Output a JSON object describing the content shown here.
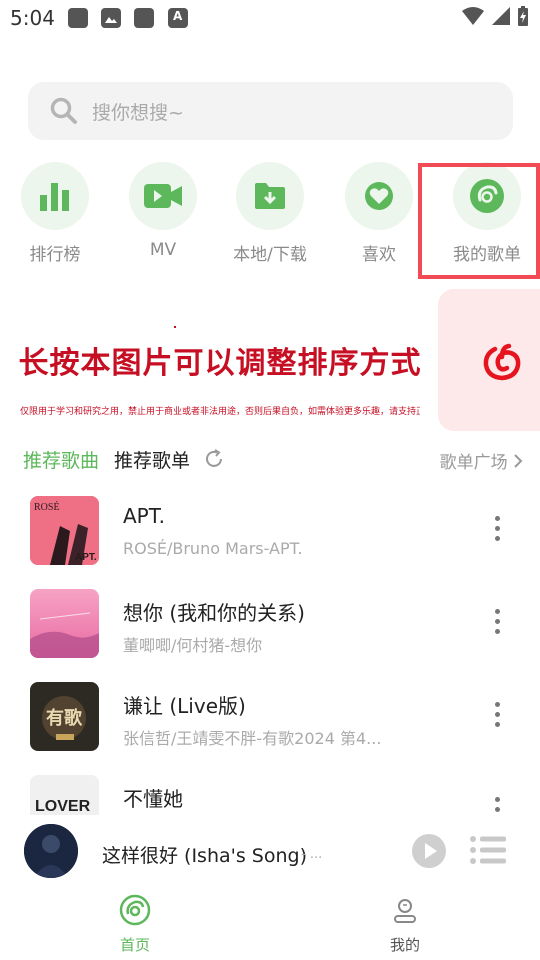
{
  "status_bar": {
    "time": "5:04"
  },
  "search": {
    "placeholder": "搜你想搜~"
  },
  "quick_menu": [
    {
      "label": "排行榜",
      "icon": "bar-chart-icon"
    },
    {
      "label": "MV",
      "icon": "video-camera-icon"
    },
    {
      "label": "本地/下载",
      "icon": "download-folder-icon"
    },
    {
      "label": "喜欢",
      "icon": "heart-icon"
    },
    {
      "label": "我的歌单",
      "icon": "disc-icon"
    }
  ],
  "banner": {
    "title": "长按本图片可以调整排序方式",
    "subtitle": "仅限用于学习和研究之用，禁止用于商业或者非法用途，否则后果自负，如需体验更多乐趣，请支持正版音乐！"
  },
  "tabs": {
    "recommend_songs": "推荐歌曲",
    "recommend_playlists": "推荐歌单",
    "plaza": "歌单广场"
  },
  "songs": [
    {
      "title": "APT.",
      "subtitle": "ROSÉ/Bruno Mars-APT."
    },
    {
      "title": "想你 (我和你的关系)",
      "subtitle": "董唧唧/何村猪-想你"
    },
    {
      "title": "谦让 (Live版)",
      "subtitle": "张信哲/王靖雯不胖-有歌2024 第4..."
    },
    {
      "title": "不懂她",
      "subtitle": ""
    }
  ],
  "player": {
    "title": "这样很好 (Isha's Song)",
    "dash": "- ..."
  },
  "nav": {
    "home": "首页",
    "mine": "我的"
  },
  "colors": {
    "accent_green": "#5cb85a",
    "highlight_red": "#f24b55",
    "banner_red": "#c70f24"
  }
}
